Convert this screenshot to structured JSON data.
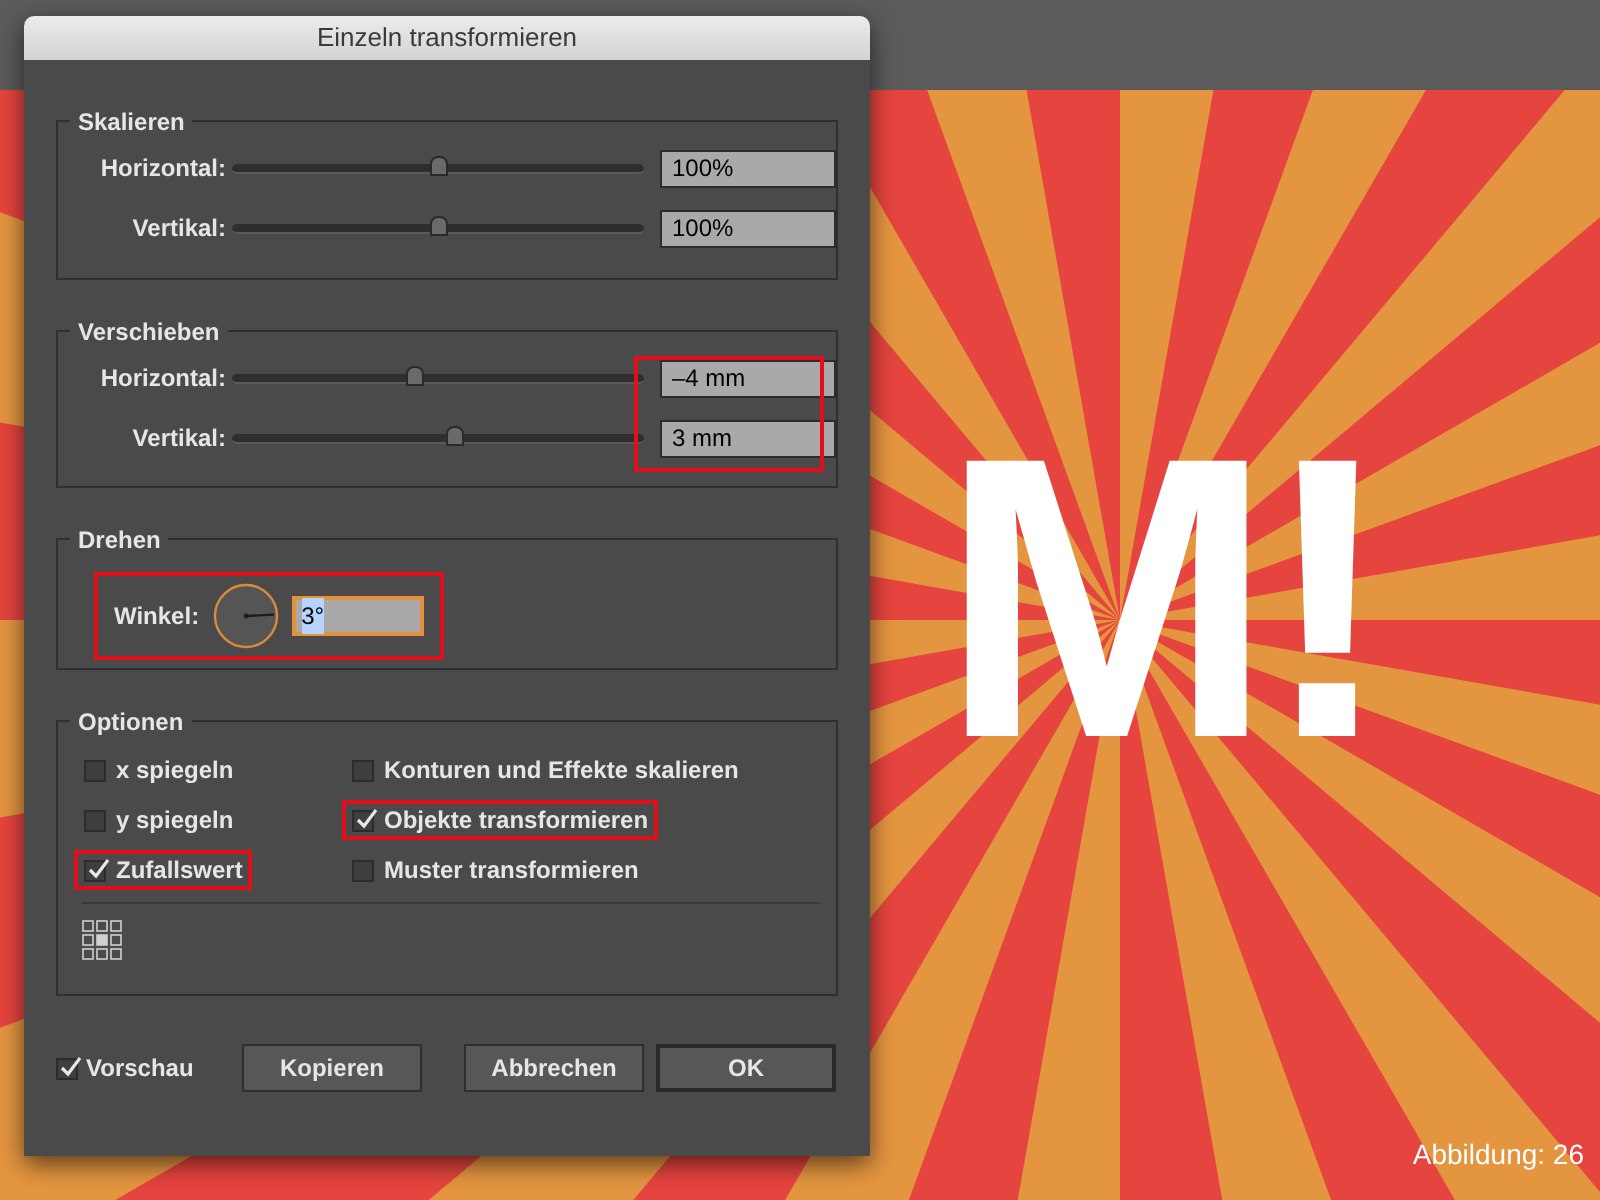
{
  "dialog": {
    "title": "Einzeln transformieren",
    "scale": {
      "legend": "Skalieren",
      "rows": [
        {
          "label": "Horizontal:",
          "level": 0.5,
          "value": "100%"
        },
        {
          "label": "Vertikal:",
          "level": 0.5,
          "value": "100%"
        }
      ]
    },
    "move": {
      "legend": "Verschieben",
      "fields_highlighted": true,
      "rows": [
        {
          "label": "Horizontal:",
          "level": 0.44,
          "value": "–4 mm"
        },
        {
          "label": "Vertikal:",
          "level": 0.54,
          "value": "3 mm"
        }
      ]
    },
    "rotate": {
      "legend": "Drehen",
      "label": "Winkel:",
      "value": "3°",
      "highlighted": true,
      "focused": true
    },
    "options": {
      "legend": "Optionen",
      "items": [
        {
          "label": "x spiegeln",
          "checked": false,
          "highlighted": false
        },
        {
          "label": "Konturen und Effekte skalieren",
          "checked": false,
          "highlighted": false
        },
        {
          "label": "y spiegeln",
          "checked": false,
          "highlighted": false
        },
        {
          "label": "Objekte transformieren",
          "checked": true,
          "highlighted": true
        },
        {
          "label": "Zufallswert",
          "checked": true,
          "highlighted": true
        },
        {
          "label": "Muster transformieren",
          "checked": false,
          "highlighted": false
        }
      ]
    },
    "preview": {
      "label": "Vorschau",
      "checked": true
    },
    "buttons": [
      {
        "label": "Kopieren",
        "default": false
      },
      {
        "label": "Abbrechen",
        "default": false
      },
      {
        "label": "OK",
        "default": true
      }
    ]
  },
  "canvas": {
    "lettering": "M!"
  },
  "caption": "Abbildung: 26"
}
